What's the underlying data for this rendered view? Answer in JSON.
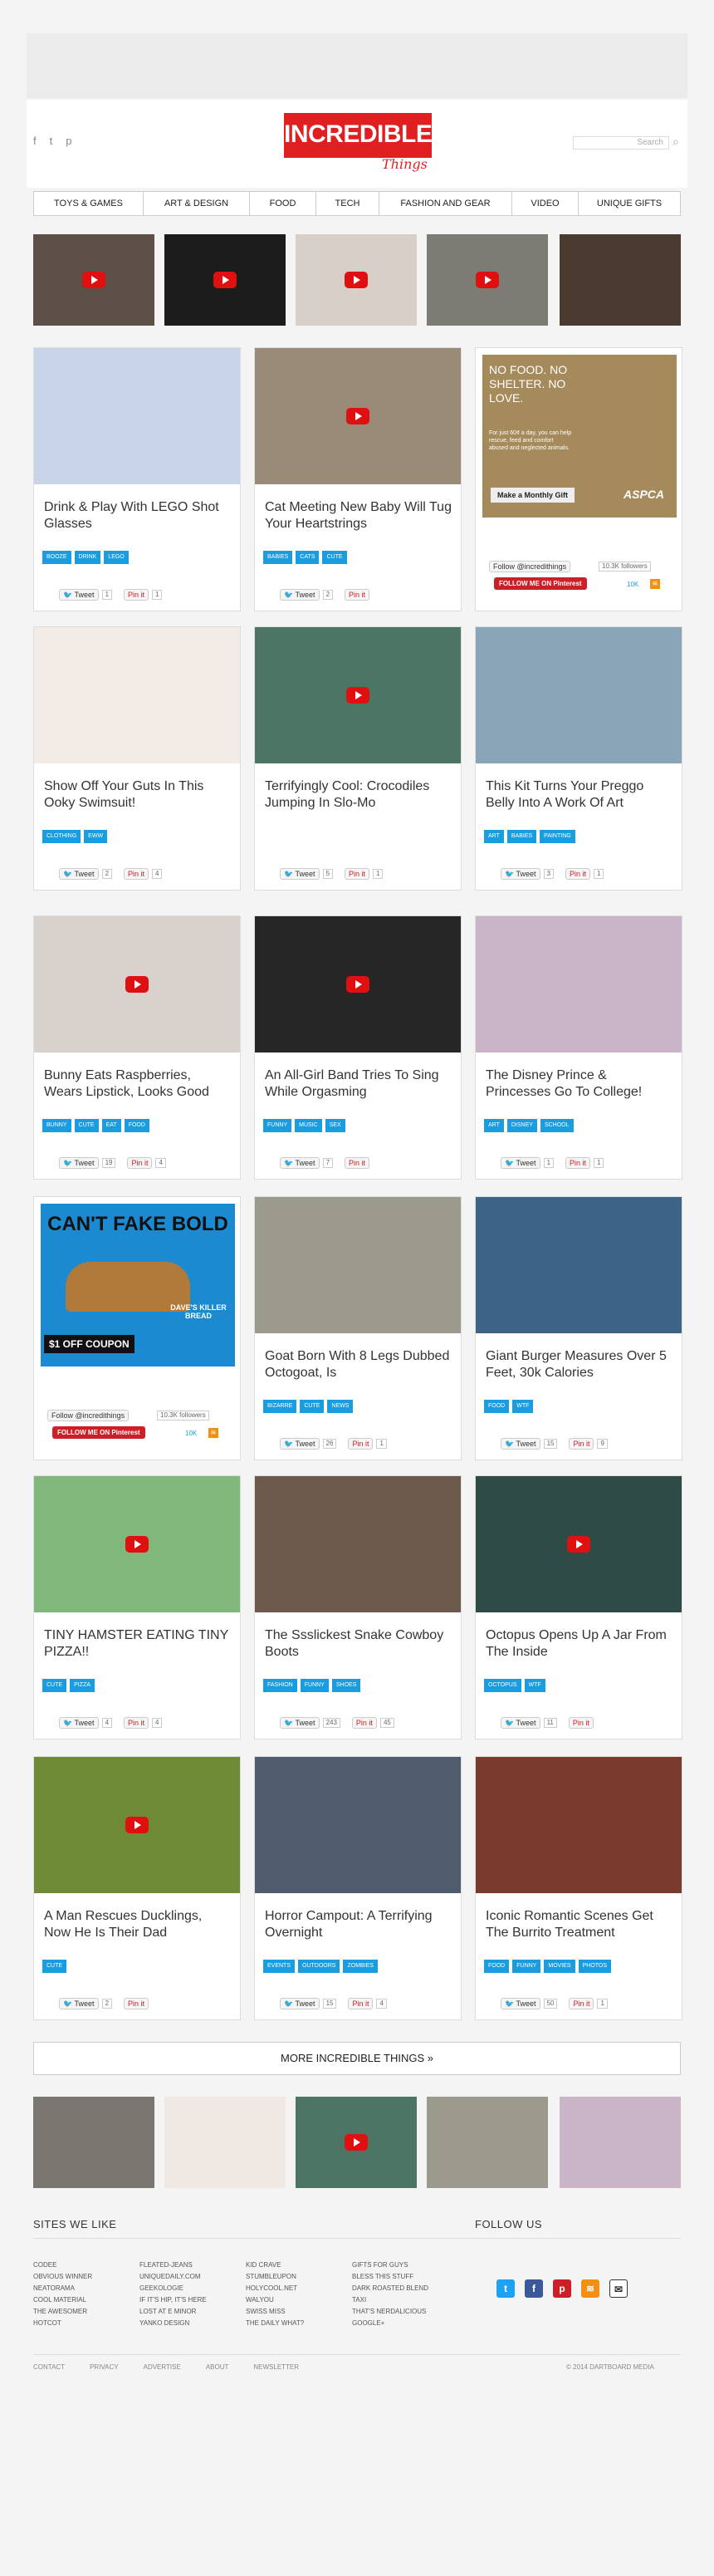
{
  "header": {
    "logo_main": "INCREDIBLE",
    "logo_sub": "Things",
    "search_placeholder": "Search",
    "social": [
      "f",
      "t",
      "p"
    ]
  },
  "nav": [
    "TOYS & GAMES",
    "ART & DESIGN",
    "FOOD",
    "TECH",
    "FASHION AND GEAR",
    "VIDEO",
    "UNIQUE GIFTS"
  ],
  "cards": [
    {
      "title": "Drink & Play With LEGO Shot Glasses",
      "tags": [
        "BOOZE",
        "DRINK",
        "LEGO"
      ],
      "tweets": "1",
      "pins": "1",
      "img_color": "#c8d4e8",
      "video": false
    },
    {
      "title": "Cat Meeting New Baby Will Tug Your Heartstrings",
      "tags": [
        "BABIES",
        "CATS",
        "CUTE"
      ],
      "tweets": "2",
      "pins": "",
      "img_color": "#9a8a78",
      "video": true
    },
    {
      "title": "Show Off Your Guts In This Ooky Swimsuit!",
      "tags": [
        "CLOTHING",
        "EWW"
      ],
      "tweets": "2",
      "pins": "4",
      "img_color": "#f3ece6",
      "video": false
    },
    {
      "title": "Terrifyingly Cool: Crocodiles Jumping In Slo-Mo",
      "tags": [],
      "tweets": "5",
      "pins": "1",
      "img_color": "#4d7566",
      "video": true
    },
    {
      "title": "This Kit Turns Your Preggo Belly Into A Work Of Art",
      "tags": [
        "ART",
        "BABIES",
        "PAINTING"
      ],
      "tweets": "3",
      "pins": "1",
      "img_color": "#8aa5b8",
      "video": false
    },
    {
      "title": "Bunny Eats Raspberries, Wears Lipstick, Looks Good",
      "tags": [
        "BUNNY",
        "CUTE",
        "EAT",
        "FOOD"
      ],
      "tweets": "19",
      "pins": "4",
      "img_color": "#d9d2cc",
      "video": true
    },
    {
      "title": "An All-Girl Band Tries To Sing While Orgasming",
      "tags": [
        "FUNNY",
        "MUSIC",
        "SEX"
      ],
      "tweets": "7",
      "pins": "",
      "img_color": "#262626",
      "video": true
    },
    {
      "title": "The Disney Prince & Princesses Go To College!",
      "tags": [
        "ART",
        "DISNEY",
        "SCHOOL"
      ],
      "tweets": "1",
      "pins": "1",
      "img_color": "#c9b4c8",
      "video": false
    },
    {
      "title": "Goat Born With 8 Legs Dubbed Octogoat, Is",
      "tags": [
        "BIZARRE",
        "CUTE",
        "NEWS"
      ],
      "tweets": "26",
      "pins": "1",
      "img_color": "#9b9a8c",
      "video": false
    },
    {
      "title": "Giant Burger Measures Over 5 Feet, 30k Calories",
      "tags": [
        "FOOD",
        "WTF"
      ],
      "tweets": "15",
      "pins": "9",
      "img_color": "#3b6487",
      "video": false
    },
    {
      "title": "TINY HAMSTER EATING TINY PIZZA!!",
      "tags": [
        "CUTE",
        "PIZZA"
      ],
      "tweets": "4",
      "pins": "4",
      "img_color": "#7fb87a",
      "video": true
    },
    {
      "title": "The Ssslickest Snake Cowboy Boots",
      "tags": [
        "FASHION",
        "FUNNY",
        "SHOES"
      ],
      "tweets": "243",
      "pins": "45",
      "img_color": "#6e5a4c",
      "video": false
    },
    {
      "title": "Octopus Opens Up A Jar From The Inside",
      "tags": [
        "OCTOPUS",
        "WTF"
      ],
      "tweets": "11",
      "pins": "",
      "img_color": "#2f4b45",
      "video": true
    },
    {
      "title": "A Man Rescues Ducklings, Now He Is Their Dad",
      "tags": [
        "CUTE"
      ],
      "tweets": "2",
      "pins": "",
      "img_color": "#6f8a36",
      "video": true
    },
    {
      "title": "Horror Campout: A Terrifying Overnight",
      "tags": [
        "EVENTS",
        "OUTDOORS",
        "ZOMBIES"
      ],
      "tweets": "15",
      "pins": "4",
      "img_color": "#4e5c6e",
      "video": false
    },
    {
      "title": "Iconic Romantic Scenes Get The Burrito Treatment",
      "tags": [
        "FOOD",
        "FUNNY",
        "MOVIES",
        "PHOTOS"
      ],
      "tweets": "50",
      "pins": "1",
      "img_color": "#7a3a2e",
      "video": false
    }
  ],
  "ads": [
    {
      "headline": "NO FOOD. NO SHELTER. NO LOVE.",
      "body": "For just 60¢ a day, you can help rescue, feed and comfort abused and neglected animals.",
      "button": "Make a Monthly Gift",
      "brand": "ASPCA",
      "follow_label": "Follow @incredithings",
      "followers": "10.3K followers",
      "pinterest": "FOLLOW ME ON Pinterest",
      "count": "10K"
    },
    {
      "headline": "CAN'T FAKE BOLD",
      "coupon": "$1 OFF COUPON",
      "brand": "DAVE'S KILLER BREAD",
      "follow_label": "Follow @incredithings",
      "followers": "10.3K followers",
      "pinterest": "FOLLOW ME ON Pinterest",
      "count": "10K"
    }
  ],
  "more_label": "MORE INCREDIBLE THINGS »",
  "footer": {
    "sites_title": "SITES WE LIKE",
    "follow_title": "FOLLOW US",
    "sites": [
      "CODEE",
      "FLEATED-JEANS",
      "KID CRAVE",
      "GIFTS FOR GUYS",
      "OBVIOUS WINNER",
      "UNIQUEDAILY.COM",
      "STUMBLEUPON",
      "BLESS THIS STUFF",
      "NEATORAMA",
      "GEEKOLOGIE",
      "HOLYCOOL.NET",
      "DARK ROASTED BLEND",
      "COOL MATERIAL",
      "IF IT'S HIP, IT'S HERE",
      "WALYOU",
      "TAXI",
      "THE AWESOMER",
      "LOST AT E MINOR",
      "SWISS MISS",
      "THAT'S NERDALICIOUS",
      "HOTCOT",
      "YANKO DESIGN",
      "THE DAILY WHAT?",
      "GOOGLE+"
    ],
    "links": [
      "CONTACT",
      "PRIVACY",
      "ADVERTISE",
      "ABOUT",
      "NEWSLETTER"
    ],
    "copyright": "© 2014 DARTBOARD MEDIA"
  },
  "label_tweet": "Tweet",
  "label_pin": "Pin it"
}
